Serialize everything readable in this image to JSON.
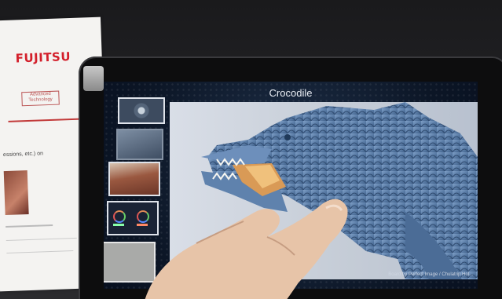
{
  "paper": {
    "brand": "FUJITSU",
    "tag": "Advanced Technology",
    "line": "essions, etc.) on"
  },
  "screen": {
    "title": "Crocodile",
    "credit": "Board by Perfect Image / Chulatrip Hol..."
  },
  "thumbnails": [
    {
      "name": "thumb-1"
    },
    {
      "name": "thumb-2"
    },
    {
      "name": "thumb-3"
    },
    {
      "name": "thumb-4"
    },
    {
      "name": "thumb-5"
    }
  ],
  "colors": {
    "brand": "#d31f2b",
    "screen_bg": "#0c1626",
    "croc": "#5c7ea8"
  }
}
